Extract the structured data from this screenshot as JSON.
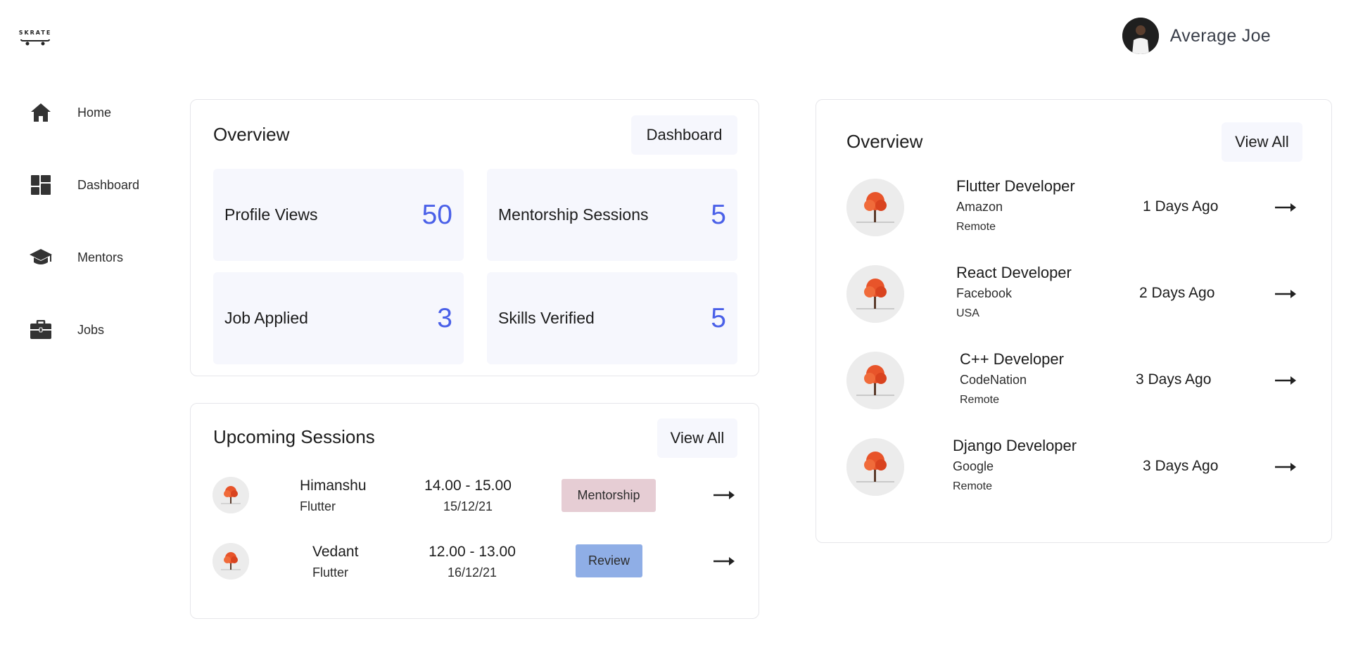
{
  "brand": {
    "logo_text": "SKRATE"
  },
  "user": {
    "name": "Average Joe"
  },
  "sidebar": {
    "items": [
      {
        "label": "Home",
        "icon": "home-icon"
      },
      {
        "label": "Dashboard",
        "icon": "dashboard-icon"
      },
      {
        "label": "Mentors",
        "icon": "graduation-cap-icon"
      },
      {
        "label": "Jobs",
        "icon": "briefcase-icon"
      }
    ]
  },
  "overview": {
    "title": "Overview",
    "button": "Dashboard",
    "stats": [
      {
        "label": "Profile Views",
        "value": "50"
      },
      {
        "label": "Mentorship Sessions",
        "value": "5"
      },
      {
        "label": "Job Applied",
        "value": "3"
      },
      {
        "label": "Skills Verified",
        "value": "5"
      }
    ]
  },
  "sessions": {
    "title": "Upcoming Sessions",
    "button": "View All",
    "rows": [
      {
        "name": "Himanshu",
        "topic": "Flutter",
        "time": "14.00 - 15.00",
        "date": "15/12/21",
        "type": "Mentorship"
      },
      {
        "name": "Vedant",
        "topic": "Flutter",
        "time": "12.00 - 13.00",
        "date": "16/12/21",
        "type": "Review"
      }
    ]
  },
  "jobs": {
    "title": "Overview",
    "button": "View All",
    "rows": [
      {
        "title": "Flutter Developer",
        "company": "Amazon",
        "location": "Remote",
        "posted": "1 Days Ago"
      },
      {
        "title": "React Developer",
        "company": "Facebook",
        "location": "USA",
        "posted": "2 Days Ago"
      },
      {
        "title": "C++ Developer",
        "company": "CodeNation",
        "location": "Remote",
        "posted": "3 Days Ago"
      },
      {
        "title": "Django Developer",
        "company": "Google",
        "location": "Remote",
        "posted": "3 Days Ago"
      }
    ]
  },
  "colors": {
    "accent": "#4a60e8",
    "card_bg": "#f6f7fd",
    "mentorship_tag": "#e6cdd4",
    "review_tag": "#8faee6"
  }
}
